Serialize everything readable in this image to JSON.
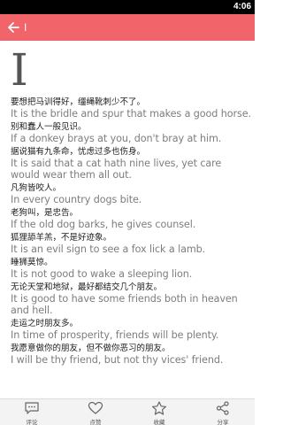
{
  "status_bar": {
    "time": "4:06"
  },
  "header": {
    "back_icon": "arrow-left-icon",
    "title": "I"
  },
  "content": {
    "letter": "I",
    "entries": [
      {
        "zh": "要想把马训得好，缰绳靴刺少不了。",
        "en": "It is the bridle and spur that makes a good horse."
      },
      {
        "zh": "别和蠢人一般见识。",
        "en": "If a donkey brays at you, don't bray at him."
      },
      {
        "zh": "据说猫有九条命，忧虑过多也伤身。",
        "en": "It is said that a cat hath nine lives, yet care would wear them all out."
      },
      {
        "zh": "凡狗皆咬人。",
        "en": "In every country dogs bite."
      },
      {
        "zh": "老狗叫，是忠告。",
        "en": "If the old dog barks, he gives counsel."
      },
      {
        "zh": "狐狸舔羊羔，不是好迹象。",
        "en": "It is an evil sign to see a fox lick a lamb."
      },
      {
        "zh": "睡狮莫惊。",
        "en": "It is not good to wake a sleeping lion."
      },
      {
        "zh": "无论天堂和地狱，最好都结交几个朋友。",
        "en": "It is good to have some friends both in heaven and hell."
      },
      {
        "zh": "走运之时朋友多。",
        "en": "In time of prosperity, friends will be plenty."
      },
      {
        "zh": "我愿意做你的朋友，但不做你恶习的朋友。",
        "en": "I will be thy friend, but not thy vices' friend."
      }
    ]
  },
  "bottom_bar": {
    "tabs": [
      {
        "name": "comment",
        "icon": "comment-icon",
        "label": "评论"
      },
      {
        "name": "like",
        "icon": "heart-icon",
        "label": "点赞"
      },
      {
        "name": "favorite",
        "icon": "star-icon",
        "label": "收藏"
      },
      {
        "name": "share",
        "icon": "share-icon",
        "label": "分享"
      }
    ]
  },
  "colors": {
    "accent": "#f0646a",
    "status_bar": "#000000",
    "english_text": "#7d7d7d",
    "chinese_text": "#1a1a1a",
    "bottom_bar": "#f3f3f3"
  }
}
